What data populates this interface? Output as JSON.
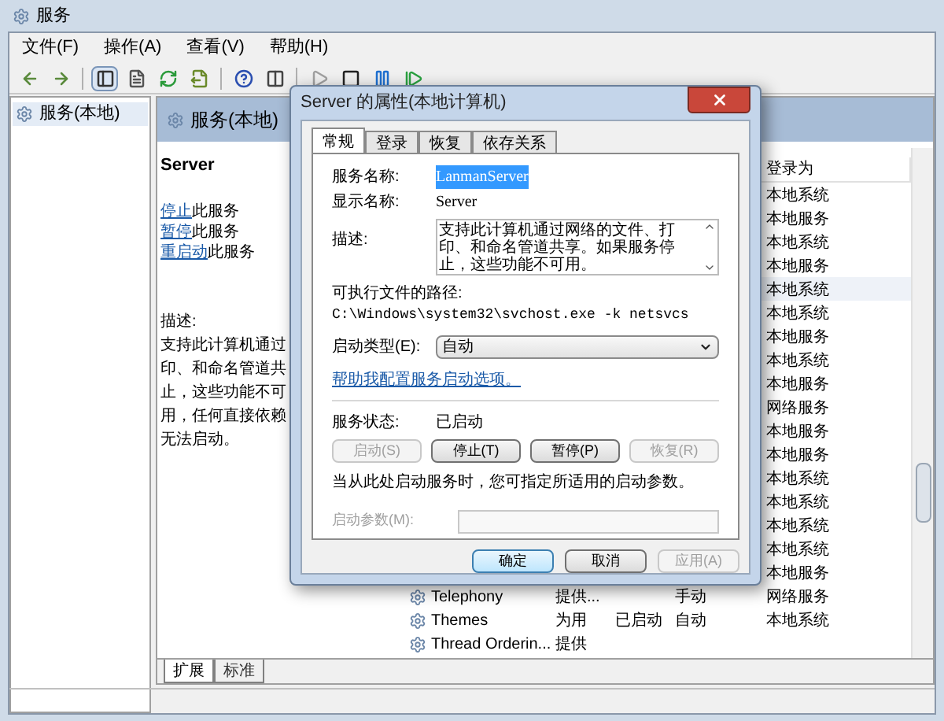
{
  "window": {
    "title": "服务"
  },
  "menu": [
    "文件(F)",
    "操作(A)",
    "查看(V)",
    "帮助(H)"
  ],
  "toolbar": [
    {
      "kind": "back",
      "disabled": false
    },
    {
      "kind": "forward",
      "disabled": false
    },
    {
      "kind": "sep"
    },
    {
      "kind": "tree",
      "pressed": true,
      "disabled": false
    },
    {
      "kind": "props",
      "disabled": false
    },
    {
      "kind": "refresh",
      "disabled": false
    },
    {
      "kind": "export",
      "disabled": false
    },
    {
      "kind": "sep"
    },
    {
      "kind": "help",
      "disabled": false
    },
    {
      "kind": "view",
      "disabled": false
    },
    {
      "kind": "sep"
    },
    {
      "kind": "play",
      "disabled": true
    },
    {
      "kind": "stop",
      "disabled": false
    },
    {
      "kind": "pause",
      "disabled": false
    },
    {
      "kind": "resume",
      "disabled": false
    }
  ],
  "tree": {
    "items": [
      {
        "label": "服务(本地)",
        "selected": true
      }
    ]
  },
  "panel": {
    "title": "服务(本地)"
  },
  "details": {
    "name": "Server",
    "actions": [
      {
        "link": "停止",
        "text": "此服务"
      },
      {
        "link": "暂停",
        "text": "此服务"
      },
      {
        "link": "重启动",
        "text": "此服务"
      }
    ],
    "description_label": "描述:",
    "description_lines": [
      "支持此计算机通过",
      "印、和命名管道共",
      "止，这些功能不可",
      "用，任何直接依赖",
      "无法启动。"
    ]
  },
  "list": {
    "column_logon": "登录为",
    "rows": [
      {
        "logon": "本地系统",
        "selected": false
      },
      {
        "logon": "本地服务",
        "selected": false
      },
      {
        "logon": "本地系统",
        "selected": false
      },
      {
        "logon": "本地服务",
        "selected": false
      },
      {
        "logon": "本地系统",
        "selected": true
      },
      {
        "logon": "本地系统",
        "selected": false
      },
      {
        "logon": "本地服务",
        "selected": false
      },
      {
        "logon": "本地系统",
        "selected": false
      },
      {
        "logon": "本地服务",
        "selected": false
      },
      {
        "logon": "网络服务",
        "selected": false
      },
      {
        "logon": "本地服务",
        "selected": false
      },
      {
        "logon": "本地服务",
        "selected": false
      },
      {
        "logon": "本地系统",
        "selected": false
      },
      {
        "logon": "本地系统",
        "selected": false
      },
      {
        "logon": "本地系统",
        "selected": false
      },
      {
        "logon": "本地系统",
        "selected": false
      },
      {
        "logon": "本地服务",
        "selected": false
      },
      {
        "name": "Telephony",
        "description": "提供...",
        "startup": "手动",
        "logon": "网络服务",
        "selected": false
      },
      {
        "name": "Themes",
        "description": "为用",
        "status": "已启动",
        "startup": "自动",
        "logon": "本地系统",
        "selected": false
      },
      {
        "name": "Thread Orderin...",
        "description": "提供",
        "selected": false
      }
    ]
  },
  "bottom_tabs": [
    {
      "label": "扩展",
      "selected": true
    },
    {
      "label": "标准",
      "selected": false
    }
  ],
  "dialog": {
    "title": "Server 的属性(本地计算机)",
    "tabs": [
      {
        "label": "常规",
        "selected": true
      },
      {
        "label": "登录",
        "selected": false
      },
      {
        "label": "恢复",
        "selected": false
      },
      {
        "label": "依存关系",
        "selected": false
      }
    ],
    "service_name_label": "服务名称:",
    "service_name": "LanmanServer",
    "service_name_highlighted": true,
    "display_name_label": "显示名称:",
    "display_name": "Server",
    "description_label": "描述:",
    "description": "支持此计算机通过网络的文件、打印、和命名管道共享。如果服务停止，这些功能不可用。",
    "path_label": "可执行文件的路径:",
    "path": "C:\\Windows\\system32\\svchost.exe -k netsvcs",
    "startup_type_label": "启动类型(E):",
    "startup_type": "自动",
    "help_link": "帮助我配置服务启动选项。",
    "status_label": "服务状态:",
    "status": "已启动",
    "service_buttons": [
      {
        "label": "启动(S)",
        "disabled": true
      },
      {
        "label": "停止(T)",
        "disabled": false
      },
      {
        "label": "暂停(P)",
        "disabled": false
      },
      {
        "label": "恢复(R)",
        "disabled": true
      }
    ],
    "hint": "当从此处启动服务时，您可指定所适用的启动参数。",
    "params": {
      "label": "启动参数(M):",
      "disabled": true
    },
    "buttons": [
      {
        "label": "确定",
        "default": true,
        "disabled": false
      },
      {
        "label": "取消",
        "default": false,
        "disabled": false
      },
      {
        "label": "应用(A)",
        "default": false,
        "disabled": true
      }
    ]
  }
}
